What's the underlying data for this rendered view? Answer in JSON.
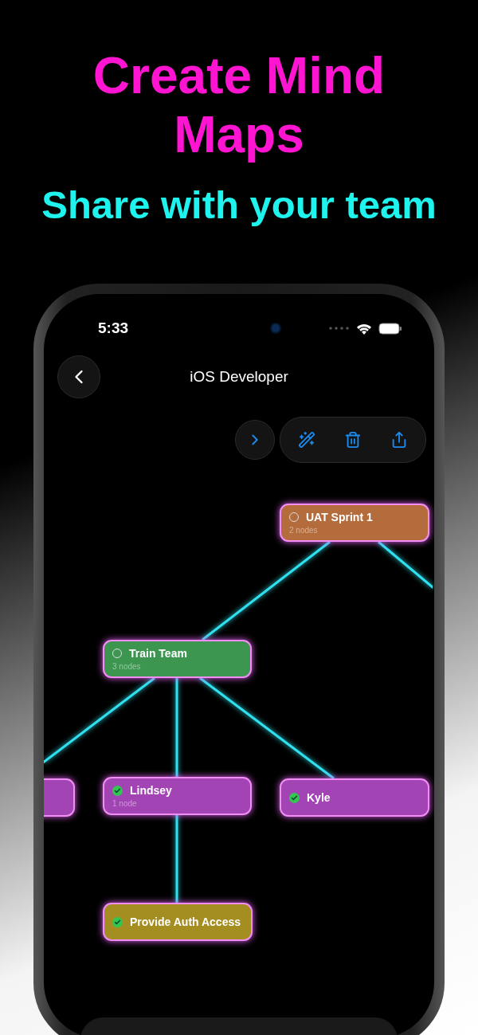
{
  "headline": {
    "title": "Create Mind Maps",
    "subtitle": "Share with your team"
  },
  "status_bar": {
    "time": "5:33"
  },
  "nav": {
    "title": "iOS Developer"
  },
  "mind_map": {
    "nodes": [
      {
        "title": "UAT Sprint 1",
        "subtitle": "2 nodes",
        "done": false,
        "color": "#b46c3c"
      },
      {
        "title": "Train Team",
        "subtitle": "3 nodes",
        "done": false,
        "color": "#3d9650"
      },
      {
        "color": "#a244b4"
      },
      {
        "title": "Lindsey",
        "subtitle": "1 node",
        "done": true,
        "color": "#a244b4"
      },
      {
        "title": "Kyle",
        "done": true,
        "color": "#a244b4"
      },
      {
        "title": "Provide Auth Access",
        "done": true,
        "color": "#a48e22"
      }
    ]
  }
}
